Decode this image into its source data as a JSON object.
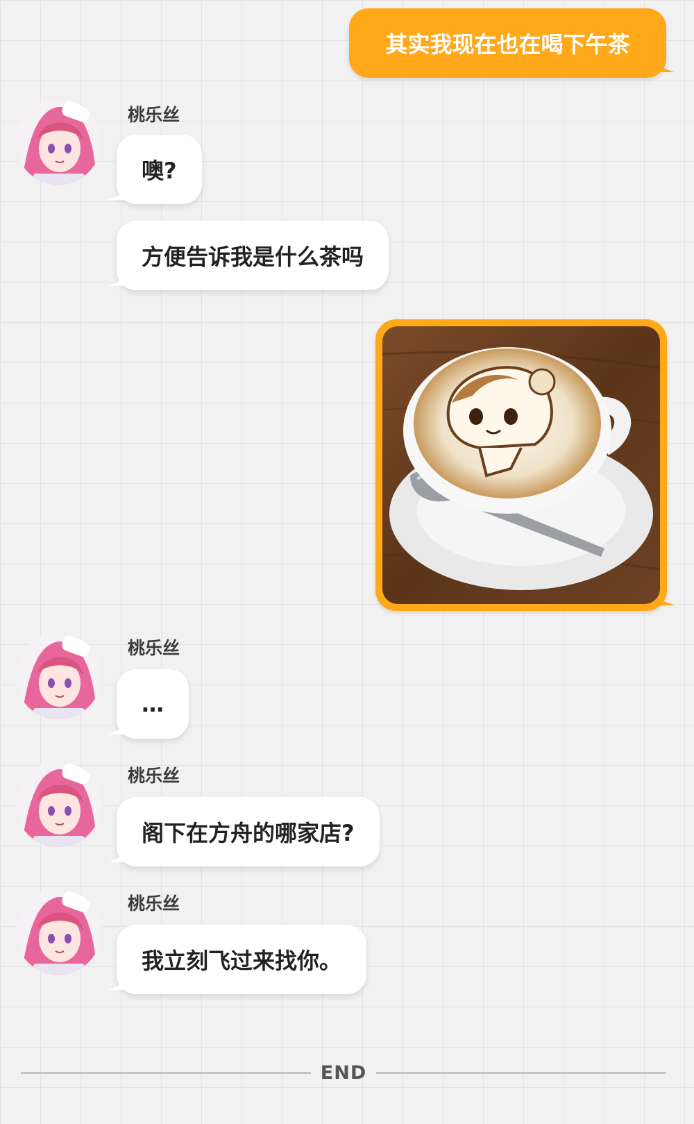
{
  "conversation": {
    "messages": [
      {
        "from": "me",
        "type": "text",
        "text": "其实我现在也在喝下午茶"
      },
      {
        "from": "contact",
        "sender": "桃乐丝",
        "type": "text",
        "text": "噢?"
      },
      {
        "from": "contact",
        "type": "text",
        "text": "方便告诉我是什么茶吗"
      },
      {
        "from": "me",
        "type": "image",
        "image": "latte-art-photo"
      },
      {
        "from": "contact",
        "sender": "桃乐丝",
        "type": "text",
        "text": "…"
      },
      {
        "from": "contact",
        "sender": "桃乐丝",
        "type": "text",
        "text": "阁下在方舟的哪家店?"
      },
      {
        "from": "contact",
        "sender": "桃乐丝",
        "type": "text",
        "text": "我立刻飞过来找你。"
      }
    ]
  },
  "end_label": "END",
  "colors": {
    "outgoing_bubble": "#fea81a",
    "incoming_bubble": "#ffffff",
    "background": "#f1f1f1",
    "avatar_hair": "#e8679a"
  },
  "icons": {
    "avatar": "avatar-icon",
    "photo": "latte-art-photo"
  }
}
